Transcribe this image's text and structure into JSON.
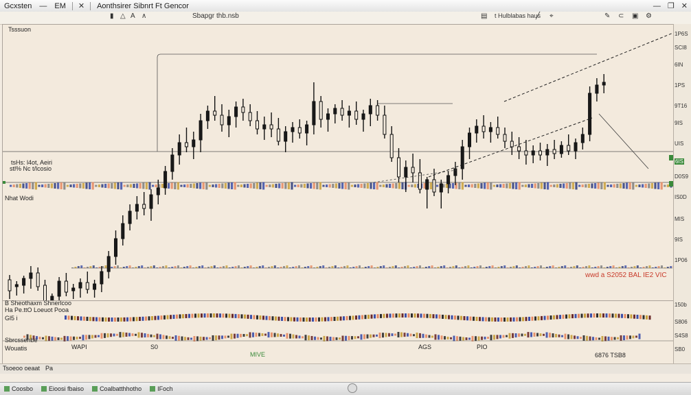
{
  "titlebar": {
    "app_label": "Gcxsten",
    "menu": "EM",
    "document": "Aonthsirer Sibnrt Ft Gencor"
  },
  "toolbar": {
    "center_text": "Sbapgr thb.nsb",
    "right_text": "t Hulblabas haus"
  },
  "chart": {
    "top_left_label": "Tsssuon",
    "mid_left_label": "tsHs: l4ot, Aeiri",
    "mid_left_label2": "stl% Nc t/lcosio",
    "lower_left_label": "Nhat Wodi",
    "bottom_right_indicator": "wwd a S2052 BAL IE2 VIC",
    "candles": [
      {
        "o": 372,
        "h": 365,
        "l": 400,
        "c": 388
      },
      {
        "o": 382,
        "h": 374,
        "l": 395,
        "c": 379
      },
      {
        "o": 380,
        "h": 366,
        "l": 392,
        "c": 370
      },
      {
        "o": 370,
        "h": 352,
        "l": 385,
        "c": 362
      },
      {
        "o": 362,
        "h": 354,
        "l": 388,
        "c": 382
      },
      {
        "o": 380,
        "h": 372,
        "l": 418,
        "c": 410
      },
      {
        "o": 406,
        "h": 392,
        "l": 416,
        "c": 396
      },
      {
        "o": 396,
        "h": 368,
        "l": 414,
        "c": 374
      },
      {
        "o": 374,
        "h": 362,
        "l": 396,
        "c": 390
      },
      {
        "o": 388,
        "h": 378,
        "l": 400,
        "c": 384
      },
      {
        "o": 384,
        "h": 370,
        "l": 398,
        "c": 376
      },
      {
        "o": 376,
        "h": 360,
        "l": 392,
        "c": 386
      },
      {
        "o": 386,
        "h": 372,
        "l": 398,
        "c": 378
      },
      {
        "o": 378,
        "h": 352,
        "l": 390,
        "c": 360
      },
      {
        "o": 360,
        "h": 330,
        "l": 370,
        "c": 338
      },
      {
        "o": 338,
        "h": 300,
        "l": 350,
        "c": 312
      },
      {
        "o": 312,
        "h": 278,
        "l": 322,
        "c": 290
      },
      {
        "o": 290,
        "h": 262,
        "l": 300,
        "c": 272
      },
      {
        "o": 272,
        "h": 250,
        "l": 284,
        "c": 262
      },
      {
        "o": 262,
        "h": 244,
        "l": 278,
        "c": 268
      },
      {
        "o": 268,
        "h": 240,
        "l": 286,
        "c": 248
      },
      {
        "o": 248,
        "h": 226,
        "l": 262,
        "c": 238
      },
      {
        "o": 238,
        "h": 206,
        "l": 248,
        "c": 214
      },
      {
        "o": 214,
        "h": 180,
        "l": 226,
        "c": 190
      },
      {
        "o": 190,
        "h": 160,
        "l": 204,
        "c": 172
      },
      {
        "o": 172,
        "h": 150,
        "l": 186,
        "c": 178
      },
      {
        "o": 178,
        "h": 156,
        "l": 196,
        "c": 168
      },
      {
        "o": 168,
        "h": 130,
        "l": 186,
        "c": 140
      },
      {
        "o": 140,
        "h": 118,
        "l": 152,
        "c": 126
      },
      {
        "o": 126,
        "h": 104,
        "l": 140,
        "c": 132
      },
      {
        "o": 132,
        "h": 116,
        "l": 156,
        "c": 146
      },
      {
        "o": 146,
        "h": 124,
        "l": 164,
        "c": 134
      },
      {
        "o": 134,
        "h": 112,
        "l": 150,
        "c": 120
      },
      {
        "o": 120,
        "h": 108,
        "l": 140,
        "c": 128
      },
      {
        "o": 128,
        "h": 116,
        "l": 148,
        "c": 140
      },
      {
        "o": 140,
        "h": 126,
        "l": 160,
        "c": 152
      },
      {
        "o": 152,
        "h": 134,
        "l": 168,
        "c": 146
      },
      {
        "o": 146,
        "h": 128,
        "l": 164,
        "c": 152
      },
      {
        "o": 152,
        "h": 136,
        "l": 176,
        "c": 170
      },
      {
        "o": 170,
        "h": 148,
        "l": 186,
        "c": 156
      },
      {
        "o": 156,
        "h": 142,
        "l": 172,
        "c": 150
      },
      {
        "o": 150,
        "h": 138,
        "l": 166,
        "c": 158
      },
      {
        "o": 158,
        "h": 140,
        "l": 176,
        "c": 146
      },
      {
        "o": 146,
        "h": 84,
        "l": 160,
        "c": 112
      },
      {
        "o": 112,
        "h": 104,
        "l": 150,
        "c": 138
      },
      {
        "o": 138,
        "h": 122,
        "l": 156,
        "c": 130
      },
      {
        "o": 130,
        "h": 116,
        "l": 144,
        "c": 122
      },
      {
        "o": 122,
        "h": 110,
        "l": 140,
        "c": 132
      },
      {
        "o": 132,
        "h": 118,
        "l": 150,
        "c": 126
      },
      {
        "o": 126,
        "h": 112,
        "l": 146,
        "c": 138
      },
      {
        "o": 138,
        "h": 124,
        "l": 156,
        "c": 130
      },
      {
        "o": 130,
        "h": 108,
        "l": 148,
        "c": 118
      },
      {
        "o": 118,
        "h": 110,
        "l": 140,
        "c": 132
      },
      {
        "o": 132,
        "h": 118,
        "l": 166,
        "c": 160
      },
      {
        "o": 160,
        "h": 148,
        "l": 200,
        "c": 194
      },
      {
        "o": 194,
        "h": 180,
        "l": 230,
        "c": 222
      },
      {
        "o": 222,
        "h": 198,
        "l": 244,
        "c": 208
      },
      {
        "o": 208,
        "h": 188,
        "l": 230,
        "c": 216
      },
      {
        "o": 216,
        "h": 196,
        "l": 246,
        "c": 240
      },
      {
        "o": 240,
        "h": 222,
        "l": 268,
        "c": 226
      },
      {
        "o": 226,
        "h": 210,
        "l": 250,
        "c": 244
      },
      {
        "o": 244,
        "h": 226,
        "l": 268,
        "c": 232
      },
      {
        "o": 232,
        "h": 214,
        "l": 246,
        "c": 220
      },
      {
        "o": 220,
        "h": 200,
        "l": 234,
        "c": 210
      },
      {
        "o": 210,
        "h": 168,
        "l": 226,
        "c": 178
      },
      {
        "o": 178,
        "h": 150,
        "l": 196,
        "c": 158
      },
      {
        "o": 158,
        "h": 138,
        "l": 172,
        "c": 148
      },
      {
        "o": 148,
        "h": 132,
        "l": 166,
        "c": 156
      },
      {
        "o": 156,
        "h": 142,
        "l": 172,
        "c": 150
      },
      {
        "o": 150,
        "h": 134,
        "l": 166,
        "c": 160
      },
      {
        "o": 160,
        "h": 150,
        "l": 180,
        "c": 170
      },
      {
        "o": 170,
        "h": 156,
        "l": 190,
        "c": 178
      },
      {
        "o": 178,
        "h": 164,
        "l": 196,
        "c": 184
      },
      {
        "o": 184,
        "h": 168,
        "l": 204,
        "c": 190
      },
      {
        "o": 190,
        "h": 176,
        "l": 202,
        "c": 184
      },
      {
        "o": 184,
        "h": 172,
        "l": 198,
        "c": 190
      },
      {
        "o": 190,
        "h": 174,
        "l": 206,
        "c": 182
      },
      {
        "o": 182,
        "h": 168,
        "l": 196,
        "c": 188
      },
      {
        "o": 188,
        "h": 170,
        "l": 194,
        "c": 176
      },
      {
        "o": 176,
        "h": 160,
        "l": 190,
        "c": 184
      },
      {
        "o": 184,
        "h": 166,
        "l": 196,
        "c": 172
      },
      {
        "o": 172,
        "h": 150,
        "l": 182,
        "c": 160
      },
      {
        "o": 160,
        "h": 90,
        "l": 170,
        "c": 100
      },
      {
        "o": 100,
        "h": 78,
        "l": 112,
        "c": 88
      },
      {
        "o": 88,
        "h": 72,
        "l": 100,
        "c": 84
      }
    ]
  },
  "oscillator": {
    "label1": "B Sheothaxm Shnerlcoo",
    "label2": "Ha Pe.ttO Loeuot Pooa",
    "label3": "Gl5 i",
    "label4": "Sbrcssenbe",
    "label5": "Wouatis",
    "axis_labels": [
      "WAPI",
      "S0",
      "MIVE",
      "AGS",
      "PIO",
      "6876 TSB8"
    ]
  },
  "right_scale": {
    "ticks": [
      "1P6S",
      "SCI8",
      "6IN",
      "1PS",
      "9T16",
      "9IS",
      "UIS",
      "6IS",
      "D0S9",
      "IS0D",
      "MIS",
      "9IS",
      "1P06",
      "150b",
      "S806",
      "S4S8",
      "SB0"
    ]
  },
  "statusbar": {
    "left": "Tsoeoo oeaat",
    "mid": "Pa"
  },
  "taskbar": {
    "items": [
      "Coosbo",
      "Eioosi fbaiso",
      "Coalbatthhotho",
      "IFoch"
    ]
  },
  "colors": {
    "bull": "#1a1a1a",
    "bear": "#111111",
    "accent_green": "#3a8a3a",
    "accent_red": "#c83a2a",
    "accent_blue": "#3b4ea8",
    "accent_orange": "#e48860"
  }
}
